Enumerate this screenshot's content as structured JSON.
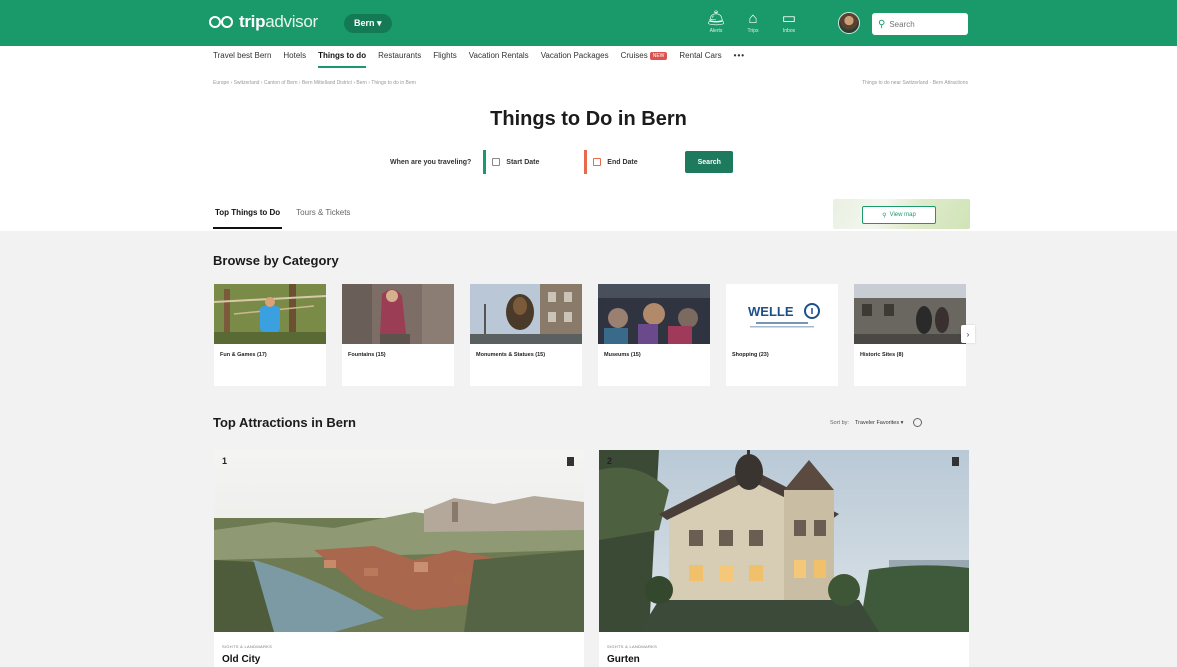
{
  "header": {
    "logo": {
      "trip": "trip",
      "advisor": "advisor"
    },
    "location_button": "Bern ▾",
    "icons": [
      {
        "name": "alerts-icon",
        "glyph": "🛎",
        "caption": "Alerts"
      },
      {
        "name": "trips-icon",
        "glyph": "⌂",
        "caption": "Trips"
      },
      {
        "name": "inbox-icon",
        "glyph": "▭",
        "caption": "Inbox"
      }
    ],
    "search_placeholder": "Search"
  },
  "nav": {
    "items": [
      {
        "label": "Travel best Bern"
      },
      {
        "label": "Hotels"
      },
      {
        "label": "Things to do",
        "active": true
      },
      {
        "label": "Restaurants"
      },
      {
        "label": "Flights"
      },
      {
        "label": "Vacation Rentals"
      },
      {
        "label": "Vacation Packages"
      },
      {
        "label": "Cruises",
        "badge": "NEW"
      },
      {
        "label": "Rental Cars"
      }
    ],
    "more": "•••"
  },
  "breadcrumb": "Europe › Switzerland › Canton of Bern › Bern Mittelland District › Bern › Things to do in Bern",
  "breadcrumb_right": "Things to do near Switzerland · Bern Attractions",
  "page": {
    "title": "Things to Do in Bern",
    "travel_question": "When are you traveling?",
    "start_date": "Start Date",
    "end_date": "End Date",
    "search_label": "Search"
  },
  "tabs": [
    {
      "label": "Top Things to Do",
      "active": true
    },
    {
      "label": "Tours & Tickets",
      "active": false
    }
  ],
  "map": {
    "button_label": "View map"
  },
  "browse": {
    "title": "Browse by Category",
    "categories": [
      {
        "label": "Fun & Games (17)"
      },
      {
        "label": "Fountains (15)"
      },
      {
        "label": "Monuments & Statues (15)"
      },
      {
        "label": "Museums (15)"
      },
      {
        "label": "Shopping (23)"
      },
      {
        "label": "Historic Sites (8)"
      }
    ],
    "welle_text": "WELLE",
    "next": "›"
  },
  "attractions": {
    "title": "Top Attractions in Bern",
    "sort_label": "Sort by:",
    "sort_value": "Traveler Favorites ▾",
    "items": [
      {
        "rank": "1",
        "type": "SIGHTS & LANDMARKS",
        "name": "Old City"
      },
      {
        "rank": "2",
        "type": "SIGHTS & LANDMARKS",
        "name": "Gurten"
      }
    ]
  },
  "colors": {
    "brand": "#1a9a6b",
    "button": "#1d7a5c",
    "end_date": "#e8694b"
  }
}
